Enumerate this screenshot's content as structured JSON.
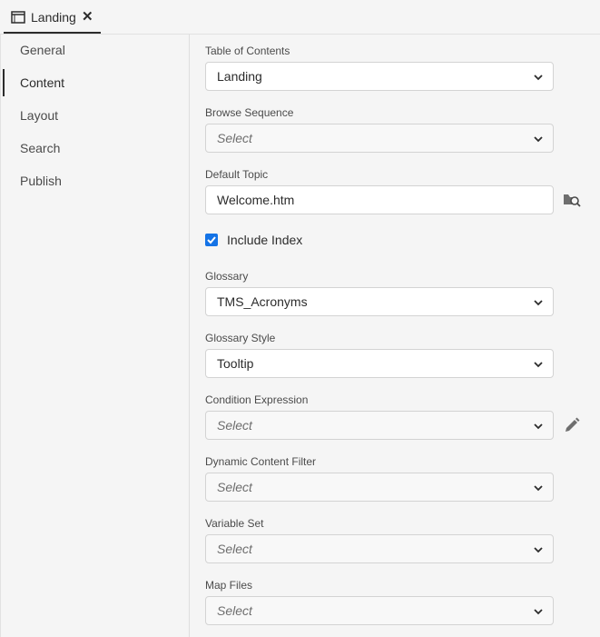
{
  "tab": {
    "label": "Landing",
    "close_glyph": "✕",
    "icon": "window-icon"
  },
  "sidebar": {
    "items": [
      {
        "label": "General",
        "active": false
      },
      {
        "label": "Content",
        "active": true
      },
      {
        "label": "Layout",
        "active": false
      },
      {
        "label": "Search",
        "active": false
      },
      {
        "label": "Publish",
        "active": false
      }
    ]
  },
  "form": {
    "toc": {
      "label": "Table of Contents",
      "value": "Landing"
    },
    "browse_sequence": {
      "label": "Browse Sequence",
      "value": "Select"
    },
    "default_topic": {
      "label": "Default Topic",
      "value": "Welcome.htm",
      "browse_icon": "folder-search-icon"
    },
    "include_index": {
      "label": "Include Index",
      "checked": true
    },
    "glossary": {
      "label": "Glossary",
      "value": "TMS_Acronyms"
    },
    "glossary_style": {
      "label": "Glossary Style",
      "value": "Tooltip"
    },
    "condition_expression": {
      "label": "Condition Expression",
      "value": "Select",
      "edit_icon": "pencil-icon"
    },
    "dynamic_content_filter": {
      "label": "Dynamic Content Filter",
      "value": "Select"
    },
    "variable_set": {
      "label": "Variable Set",
      "value": "Select"
    },
    "map_files": {
      "label": "Map Files",
      "value": "Select"
    }
  },
  "colors": {
    "accent": "#1473e6",
    "text": "#2c2c2c",
    "border": "#d3d3d3",
    "panel": "#f5f5f5"
  }
}
